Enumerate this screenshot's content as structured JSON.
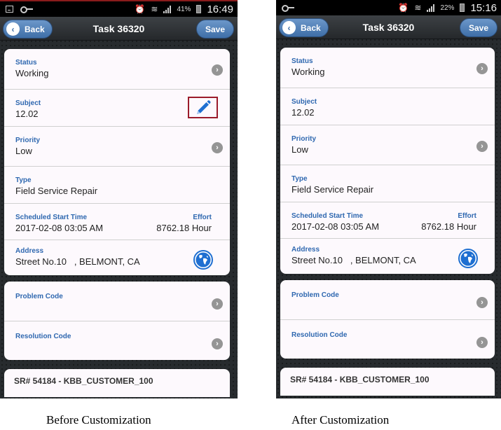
{
  "screens": {
    "before": {
      "status_bar": {
        "battery_pct": "41%",
        "time": "16:49"
      },
      "caption": "Before Customization"
    },
    "after": {
      "status_bar": {
        "battery_pct": "22%",
        "time": "15:16"
      },
      "caption": "After Customization"
    }
  },
  "nav": {
    "back_label": "Back",
    "title": "Task 36320",
    "save_label": "Save"
  },
  "fields": {
    "status": {
      "label": "Status",
      "value": "Working"
    },
    "subject": {
      "label": "Subject",
      "value": "12.02"
    },
    "priority": {
      "label": "Priority",
      "value": "Low"
    },
    "type": {
      "label": "Type",
      "value": "Field Service Repair"
    },
    "scheduled_start": {
      "label": "Scheduled Start Time",
      "value": "2017-02-08 03:05 AM"
    },
    "effort": {
      "label": "Effort",
      "value": "8762.18 Hour"
    },
    "address": {
      "label": "Address",
      "value": "Street No.10   , BELMONT, CA"
    },
    "problem_code": {
      "label": "Problem Code",
      "value": ""
    },
    "resolution_code": {
      "label": "Resolution Code",
      "value": ""
    }
  },
  "service_request": {
    "title": "SR# 54184 - KBB_CUSTOMER_100"
  },
  "icons": {
    "chevron": "chevron-right-icon",
    "edit": "pencil-icon",
    "map": "globe-icon"
  },
  "colors": {
    "label_blue": "#2f68b0",
    "highlight_border": "#9b1b2b",
    "button_blue": "#4f7fb8"
  }
}
